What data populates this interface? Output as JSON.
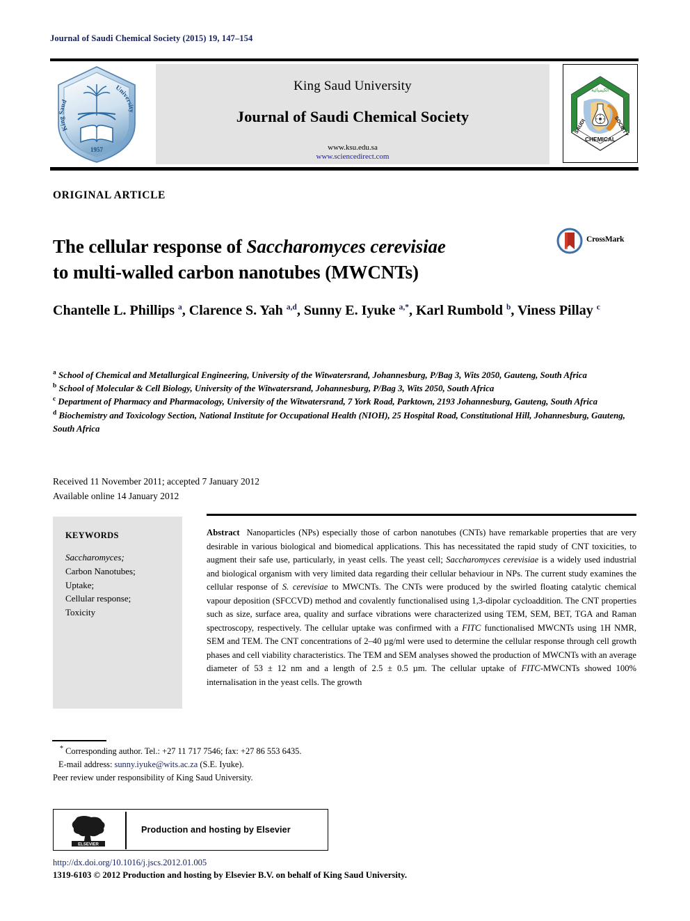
{
  "running_head": "Journal of Saudi Chemical Society (2015) 19, 147–154",
  "masthead": {
    "university": "King Saud University",
    "journal": "Journal of Saudi Chemical Society",
    "url_ksu": "www.ksu.edu.sa",
    "url_sciencedirect": "www.sciencedirect.com",
    "ksu_logo": {
      "alt": "king-saud-university-shield",
      "text_left": "King Saud",
      "text_right": "University",
      "year": "1957"
    },
    "scs_logo": {
      "alt": "saudi-chemical-society-hexagon",
      "label_left": "SAUDI",
      "label_right": "SOCIETY",
      "label_bottom": "CHEMICAL"
    }
  },
  "article_type": "ORIGINAL ARTICLE",
  "title": {
    "line1_pre": "The cellular response of ",
    "line1_italic": "Saccharomyces cerevisiae",
    "line2": "to multi-walled carbon nanotubes (MWCNTs)"
  },
  "crossmark": {
    "label": "CrossMark"
  },
  "authors": [
    {
      "name": "Chantelle L. Phillips",
      "sup": "a",
      "sep": ", "
    },
    {
      "name": "Clarence S. Yah",
      "sup": "a,d",
      "sep": ", "
    },
    {
      "name": "Sunny E. Iyuke",
      "sup": "a,*",
      "sep": ", "
    },
    {
      "name": "Karl Rumbold",
      "sup": "b",
      "sep": ", "
    },
    {
      "name": "Viness Pillay",
      "sup": "c",
      "sep": ""
    }
  ],
  "affiliations": [
    {
      "marker": "a",
      "text": "School of Chemical and Metallurgical Engineering, University of the Witwatersrand, Johannesburg, P/Bag 3, Wits 2050, Gauteng, South Africa"
    },
    {
      "marker": "b",
      "text": "School of Molecular & Cell Biology, University of the Witwatersrand, Johannesburg, P/Bag 3, Wits 2050, South Africa"
    },
    {
      "marker": "c",
      "text": "Department of Pharmacy and Pharmacology, University of the Witwatersrand, 7 York Road, Parktown, 2193 Johannesburg, Gauteng, South Africa"
    },
    {
      "marker": "d",
      "text": "Biochemistry and Toxicology Section, National Institute for Occupational Health (NIOH), 25 Hospital Road, Constitutional Hill, Johannesburg, Gauteng, South Africa"
    }
  ],
  "dates": {
    "received": "Received 11 November 2011; accepted 7 January 2012",
    "available": "Available online 14 January 2012"
  },
  "keywords": {
    "heading": "KEYWORDS",
    "items": [
      "Saccharomyces;",
      "Carbon Nanotubes;",
      "Uptake;",
      "Cellular response;",
      "Toxicity"
    ]
  },
  "abstract": {
    "label": "Abstract",
    "p1": "Nanoparticles (NPs) especially those of carbon nanotubes (CNTs) have remarkable properties that are very desirable in various biological and biomedical applications. This has necessitated the rapid study of CNT toxicities, to augment their safe use, particularly, in yeast cells. The yeast cell; ",
    "it1": "Saccharomyces cerevisiae",
    "p2": " is a widely used industrial and biological organism with very limited data regarding their cellular behaviour in NPs. The current study examines the cellular response of ",
    "it2": "S. cerevisiae",
    "p3": " to MWCNTs. The CNTs were produced by the swirled floating catalytic chemical vapour deposition (SFCCVD) method and covalently functionalised using 1,3-dipolar cycloaddition. The CNT properties such as size, surface area, quality and surface vibrations were characterized using TEM, SEM, BET, TGA and Raman spectroscopy, respectively. The cellular uptake was confirmed with a ",
    "it3": "FITC",
    "p4": " functionalised MWCNTs using 1H NMR, SEM and TEM. The CNT concentrations of 2–40 µg/ml were used to determine the cellular response through cell growth phases and cell viability characteristics. The TEM and SEM analyses showed the production of MWCNTs with an average diameter of 53 ± 12 nm and a length of 2.5 ± 0.5 µm. The cellular uptake of ",
    "it4": "FITC",
    "p5": "-MWCNTs showed 100% internalisation in the yeast cells. The growth"
  },
  "footnotes": {
    "corresponding": "Corresponding author. Tel.: +27 11 717 7546; fax: +27 86 553 6435.",
    "email_label": "E-mail address:",
    "email": "sunny.iyuke@wits.ac.za",
    "email_owner": "(S.E. Iyuke).",
    "peer_review": "Peer review under responsibility of King Saud University."
  },
  "elsevier": {
    "logo_label": "ELSEVIER",
    "text": "Production and hosting by Elsevier"
  },
  "bottom": {
    "doi": "http://dx.doi.org/10.1016/j.jscs.2012.01.005",
    "copyright": "1319-6103 © 2012 Production and hosting by Elsevier B.V. on behalf of King Saud University."
  },
  "colors": {
    "running_head": "#15215e",
    "link": "#1a1aaa",
    "sup": "#15215e",
    "masthead_bg": "#e3e3e3",
    "keywords_bg": "#e3e3e3"
  }
}
